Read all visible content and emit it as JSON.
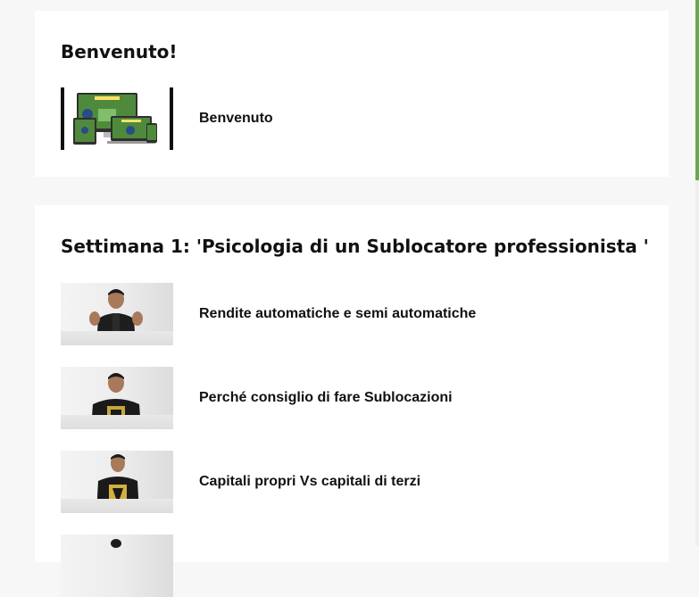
{
  "welcome": {
    "title": "Benvenuto!",
    "lesson_label": "Benvenuto"
  },
  "week1": {
    "title": "Settimana 1: 'Psicologia di un Sublocatore professionista '",
    "lessons": [
      {
        "label": "Rendite automatiche e semi automatiche"
      },
      {
        "label": "Perché consiglio di fare Sublocazioni"
      },
      {
        "label": "Capitali propri Vs capitali di terzi"
      },
      {
        "label": ""
      }
    ]
  },
  "colors": {
    "accent": "#6aa84f",
    "background": "#f7f7f7",
    "card": "#ffffff"
  }
}
